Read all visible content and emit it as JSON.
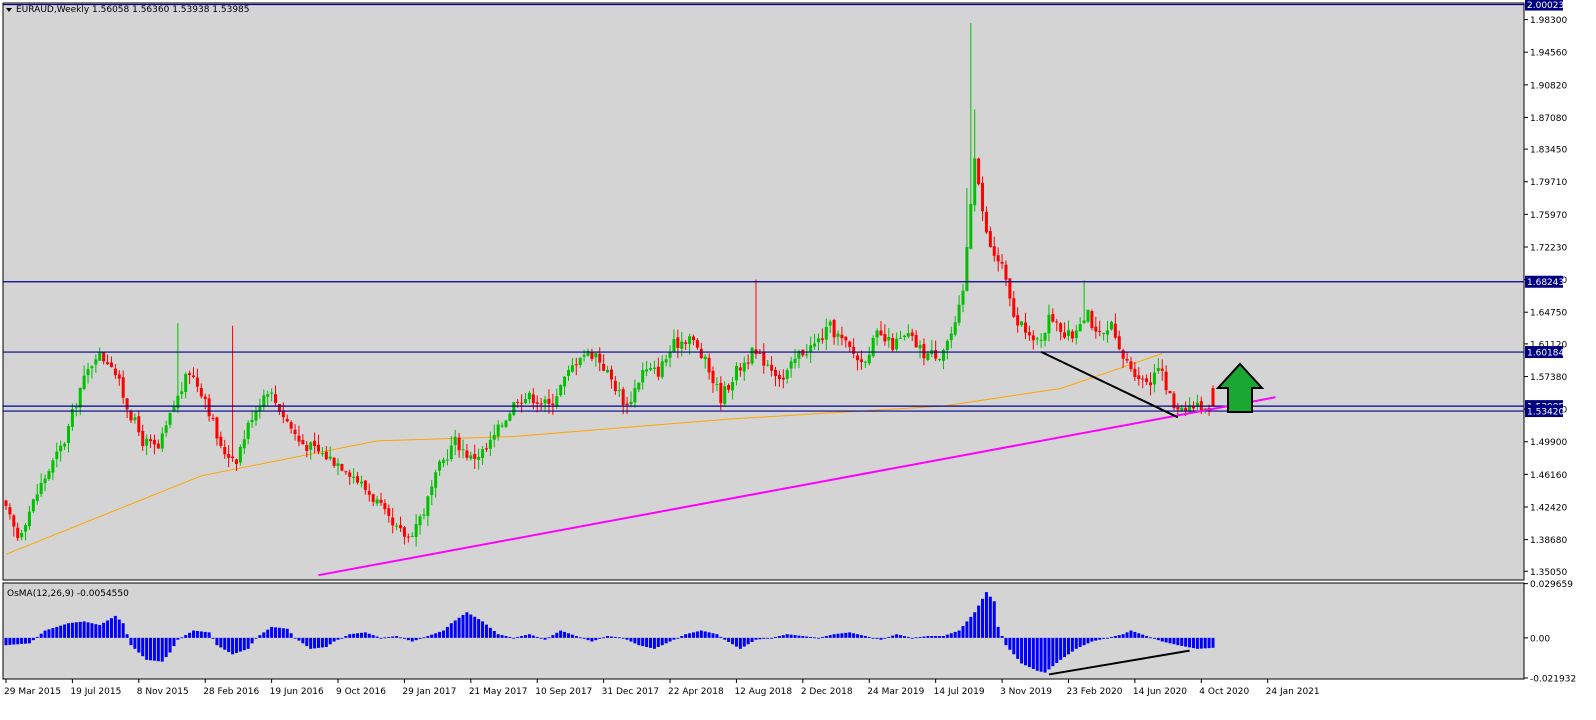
{
  "window": {
    "main_title": "EURAUD,Weekly  1.56058 1.56360 1.53938 1.53985",
    "indicator_title": "OsMA(12,26,9) -0.0054550"
  },
  "colors": {
    "background": "#d4d4d4",
    "frame": "#000000",
    "bull_candle": "#00c000",
    "bear_candle": "#ff0000",
    "moving_average": "#ffa500",
    "support_line": "#ff00ff",
    "trend_line": "#000000",
    "level_line": "#00008b",
    "histogram": "#0000ff",
    "arrow_fill": "#1aa832",
    "price_tag_bg": "#000080",
    "price_tag_text": "#ffffff"
  },
  "chart_data": [
    {
      "type": "candlestick",
      "symbol": "EURAUD",
      "timeframe": "Weekly",
      "last_bar": {
        "open": 1.56058,
        "high": 1.5636,
        "low": 1.53938,
        "close": 1.53985
      },
      "ylim": [
        1.3405,
        2.002
      ],
      "y_ticks": [
        "1.98300",
        "1.94560",
        "1.90820",
        "1.87080",
        "1.83450",
        "1.79710",
        "1.75970",
        "1.72230",
        "1.68490",
        "1.64750",
        "1.61120",
        "1.57380",
        "1.53640",
        "1.49900",
        "1.46160",
        "1.42420",
        "1.38680",
        "1.35050"
      ],
      "x_labels": [
        "29 Mar 2015",
        "19 Jul 2015",
        "8 Nov 2015",
        "28 Feb 2016",
        "19 Jun 2016",
        "9 Oct 2016",
        "29 Jan 2017",
        "21 May 2017",
        "10 Sep 2017",
        "31 Dec 2017",
        "22 Apr 2018",
        "12 Aug 2018",
        "2 Dec 2018",
        "24 Mar 2019",
        "14 Jul 2019",
        "3 Nov 2019",
        "23 Feb 2020",
        "14 Jun 2020",
        "4 Oct 2020",
        "24 Jan 2021"
      ],
      "horizontal_levels": [
        {
          "price": 2.00023,
          "label": "2.00023"
        },
        {
          "price": 1.68243,
          "label": "1.68243"
        },
        {
          "price": 1.60184,
          "label": "1.60184"
        },
        {
          "price": 1.53985,
          "label": "1.53985"
        },
        {
          "price": 1.5342,
          "label": "1.53420"
        }
      ],
      "moving_average_anchor_points": [
        {
          "week": 0,
          "price": 1.37
        },
        {
          "week": 50,
          "price": 1.46
        },
        {
          "week": 95,
          "price": 1.5
        },
        {
          "week": 130,
          "price": 1.505
        },
        {
          "week": 185,
          "price": 1.525
        },
        {
          "week": 240,
          "price": 1.54
        },
        {
          "week": 270,
          "price": 1.56
        },
        {
          "week": 296,
          "price": 1.6
        }
      ],
      "support_line": [
        {
          "week": 80,
          "price": 1.346
        },
        {
          "week": 325,
          "price": 1.55
        }
      ],
      "trend_line": [
        {
          "week": 265,
          "price": 1.602
        },
        {
          "week": 300,
          "price": 1.527
        }
      ],
      "signal": "up-arrow"
    },
    {
      "type": "histogram",
      "name": "OsMA(12,26,9)",
      "last_value": -0.005455,
      "ylim": [
        -0.0225,
        0.03
      ],
      "y_ticks": [
        "0.029659",
        "0.00",
        "-0.021932"
      ],
      "divergence_line": [
        {
          "week": 267,
          "value": -0.02
        },
        {
          "week": 303,
          "value": -0.007
        }
      ]
    }
  ]
}
